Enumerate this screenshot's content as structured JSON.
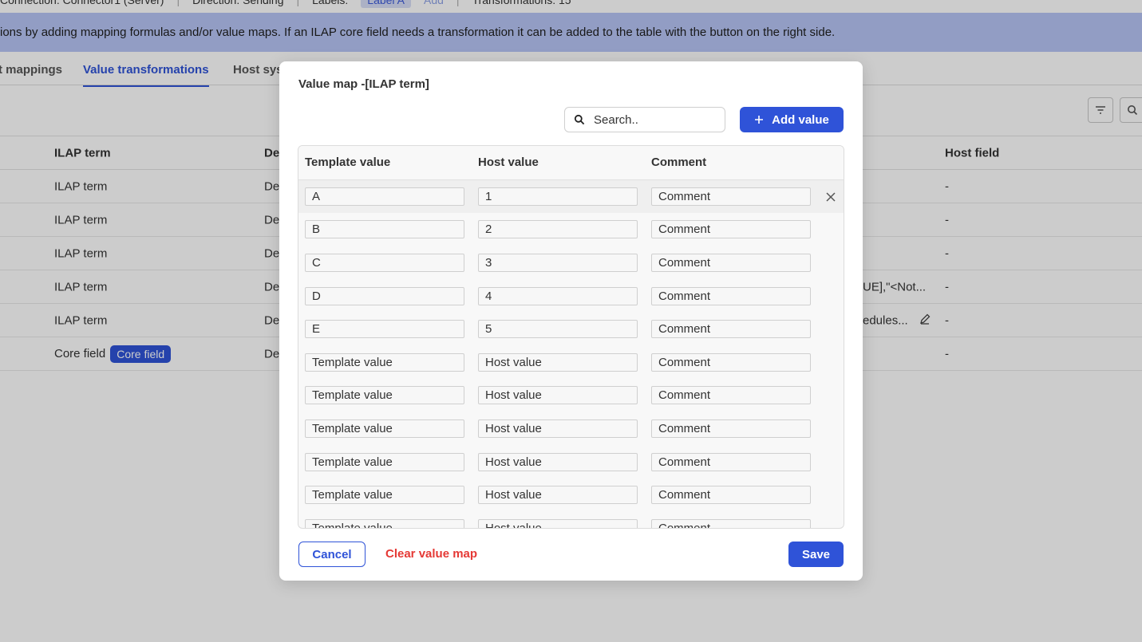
{
  "background": {
    "topbar": {
      "items": [
        "Connection: Connector1 (Server)",
        "Direction: Sending",
        "Labels:",
        "Label A",
        "Add",
        "Transformations: 15"
      ]
    },
    "banner_text": "ions by adding mapping formulas and/or value maps. If an ILAP core field needs a transformation it can be added to the table with the button on the right side.",
    "tabs": [
      "t mappings",
      "Value transformations",
      "Host sys"
    ],
    "table": {
      "headers": {
        "ilap_term": "ILAP term",
        "de": "De",
        "host_field": "Host field"
      },
      "rows": [
        {
          "term": "ILAP term",
          "de": "De",
          "extra": "",
          "host": "-"
        },
        {
          "term": "ILAP term",
          "de": "De",
          "extra": "",
          "host": "-"
        },
        {
          "term": "ILAP term",
          "de": "De",
          "extra": "",
          "host": "-"
        },
        {
          "term": "ILAP term",
          "de": "De",
          "extra": "UE],\"<Not...",
          "host": "-"
        },
        {
          "term": "ILAP term",
          "de": "De",
          "extra": "edules...",
          "host": "-"
        },
        {
          "term": "Core field",
          "badge": "Core field",
          "de": "De",
          "extra": "",
          "host": "-"
        }
      ]
    }
  },
  "modal": {
    "title": "Value map -[ILAP term]",
    "search_placeholder": "Search..",
    "add_value_label": "Add value",
    "columns": {
      "template": "Template value",
      "host": "Host value",
      "comment": "Comment"
    },
    "rows": [
      {
        "template": "A",
        "host": "1",
        "comment": "Comment"
      },
      {
        "template": "B",
        "host": "2",
        "comment": "Comment"
      },
      {
        "template": "C",
        "host": "3",
        "comment": "Comment"
      },
      {
        "template": "D",
        "host": "4",
        "comment": "Comment"
      },
      {
        "template": "E",
        "host": "5",
        "comment": "Comment"
      },
      {
        "template": "Template value",
        "host": "Host value",
        "comment": "Comment"
      },
      {
        "template": "Template value",
        "host": "Host value",
        "comment": "Comment"
      },
      {
        "template": "Template value",
        "host": "Host value",
        "comment": "Comment"
      },
      {
        "template": "Template value",
        "host": "Host value",
        "comment": "Comment"
      },
      {
        "template": "Template value",
        "host": "Host value",
        "comment": "Comment"
      },
      {
        "template": "Template value",
        "host": "Host value",
        "comment": "Comment"
      }
    ],
    "cancel_label": "Cancel",
    "clear_label": "Clear value map",
    "save_label": "Save"
  },
  "colors": {
    "primary": "#2f53d8",
    "danger": "#e53935",
    "banner": "#b7c5f5"
  }
}
